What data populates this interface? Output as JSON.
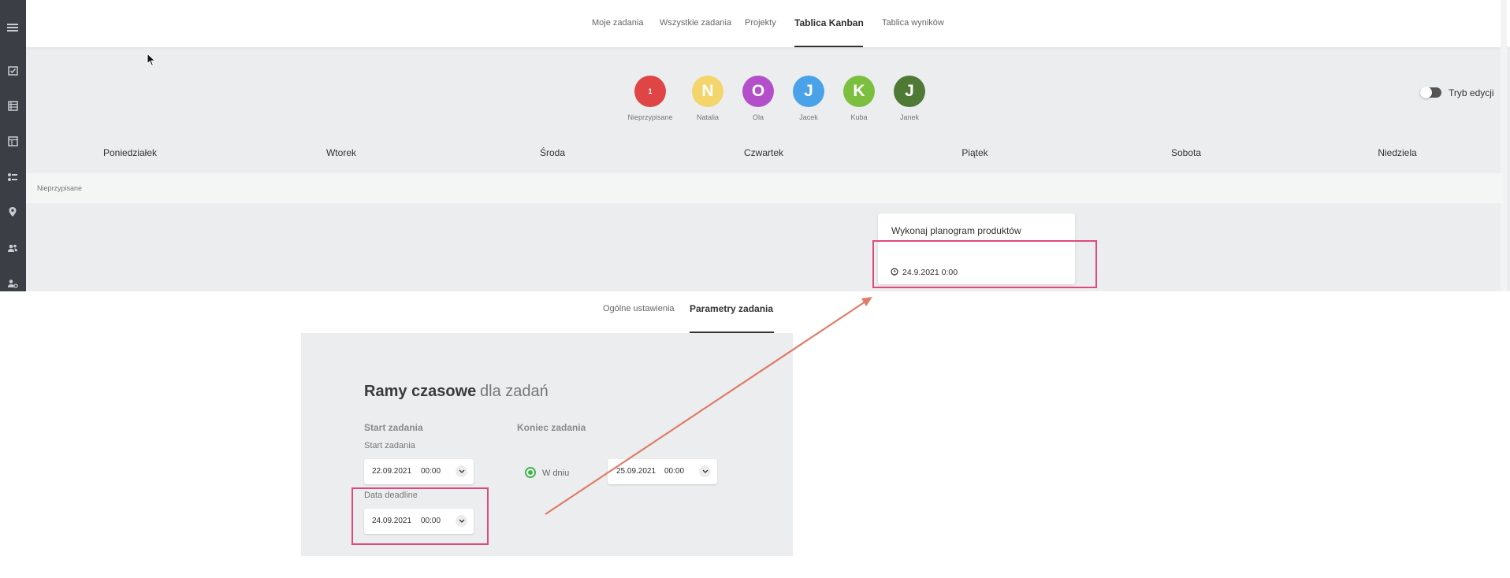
{
  "topnav": {
    "tabs": [
      {
        "label": "Moje zadania"
      },
      {
        "label": "Wszystkie zadania"
      },
      {
        "label": "Projekty"
      },
      {
        "label": "Tablica Kanban"
      },
      {
        "label": "Tablica wyników"
      }
    ],
    "active_tab": "Tablica Kanban"
  },
  "sidebar": {
    "icons": [
      "menu-icon",
      "task-check-icon",
      "list-icon",
      "board-icon",
      "routes-icon",
      "location-pin-icon",
      "users-group-icon",
      "user-settings-icon"
    ]
  },
  "avatars": [
    {
      "initial": "1",
      "name": "Nieprzypisane",
      "color": "#e04545"
    },
    {
      "initial": "N",
      "name": "Natalia",
      "color": "#f3d56b"
    },
    {
      "initial": "O",
      "name": "Ola",
      "color": "#b24fc9"
    },
    {
      "initial": "J",
      "name": "Jacek",
      "color": "#4aa3e8"
    },
    {
      "initial": "K",
      "name": "Kuba",
      "color": "#7cbf3f"
    },
    {
      "initial": "J",
      "name": "Janek",
      "color": "#4f7a35"
    }
  ],
  "edit_mode": {
    "label": "Tryb edycji",
    "enabled": false
  },
  "days": [
    "Poniedziałek",
    "Wtorek",
    "Środa",
    "Czwartek",
    "Piątek",
    "Sobota",
    "Niedziela"
  ],
  "lane": {
    "label": "Nieprzypisane"
  },
  "card": {
    "title": "Wykonaj planogram produktów",
    "date": "24.9.2021 0:00",
    "day": "Piątek"
  },
  "lower_tabs": [
    {
      "label": "Ogólne ustawienia"
    },
    {
      "label": "Parametry zadania"
    }
  ],
  "lower_active_tab": "Parametry zadania",
  "panel": {
    "title": "Ramy czasowe",
    "subtitle": "dla zadań",
    "start_head": "Start zadania",
    "start_label": "Start zadania",
    "start_date": "22.09.2021",
    "start_time": "00:00",
    "deadline_label": "Data deadline",
    "deadline_date": "24.09.2021",
    "deadline_time": "00:00",
    "end_head": "Koniec zadania",
    "end_option": "W dniu",
    "end_date": "25.09.2021",
    "end_time": "00:00"
  },
  "colors": {
    "highlight": "#e0497d",
    "arrow": "#e07b6a",
    "radio": "#3fb34f",
    "sidebar": "#3b3f45"
  }
}
